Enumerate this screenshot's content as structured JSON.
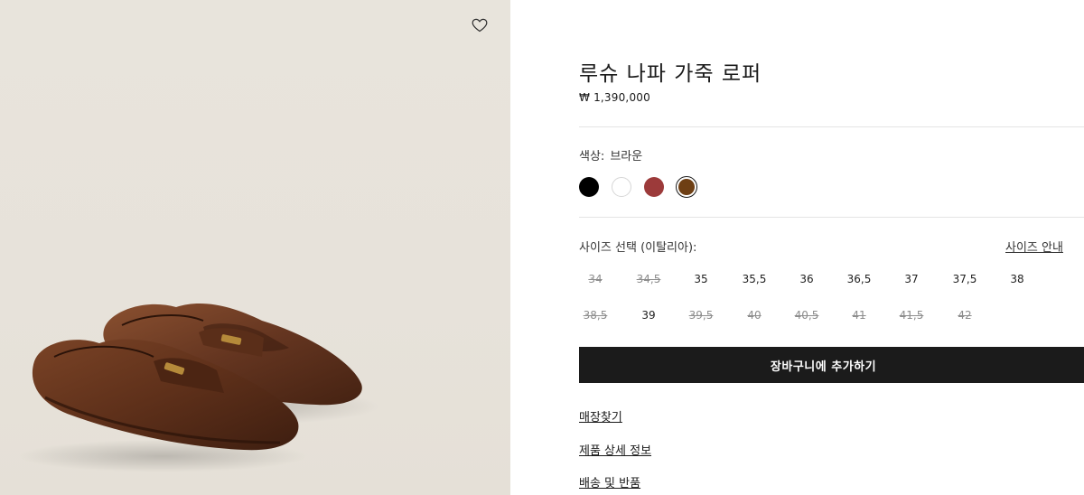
{
  "product": {
    "title": "루슈 나파 가죽 로퍼",
    "price": "₩ 1,390,000",
    "image_alt": "brown-nappa-leather-loafers"
  },
  "wishlist": {
    "icon": "heart-outline-icon"
  },
  "color": {
    "label": "색상:",
    "selected": "브라운",
    "swatches": [
      {
        "name": "black",
        "hex": "#000000"
      },
      {
        "name": "white",
        "hex": "#ffffff"
      },
      {
        "name": "red",
        "hex": "#9c3a3a"
      },
      {
        "name": "brown",
        "hex": "#6e3f14",
        "selected": true
      }
    ]
  },
  "size": {
    "label": "사이즈 선택 (이탈리아):",
    "guide_label": "사이즈 안내",
    "rows": [
      [
        {
          "value": "34",
          "available": false
        },
        {
          "value": "34,5",
          "available": false
        },
        {
          "value": "35",
          "available": true
        },
        {
          "value": "35,5",
          "available": true
        },
        {
          "value": "36",
          "available": true
        },
        {
          "value": "36,5",
          "available": true
        },
        {
          "value": "37",
          "available": true
        },
        {
          "value": "37,5",
          "available": true
        },
        {
          "value": "38",
          "available": true
        }
      ],
      [
        {
          "value": "38,5",
          "available": false
        },
        {
          "value": "39",
          "available": true
        },
        {
          "value": "39,5",
          "available": false
        },
        {
          "value": "40",
          "available": false
        },
        {
          "value": "40,5",
          "available": false
        },
        {
          "value": "41",
          "available": false
        },
        {
          "value": "41,5",
          "available": false
        },
        {
          "value": "42",
          "available": false
        }
      ]
    ]
  },
  "cart": {
    "add_label": "장바구니에 추가하기"
  },
  "links": {
    "store_finder": "매장찾기",
    "product_details": "제품 상세 정보",
    "shipping_returns": "배송 및 반품"
  }
}
